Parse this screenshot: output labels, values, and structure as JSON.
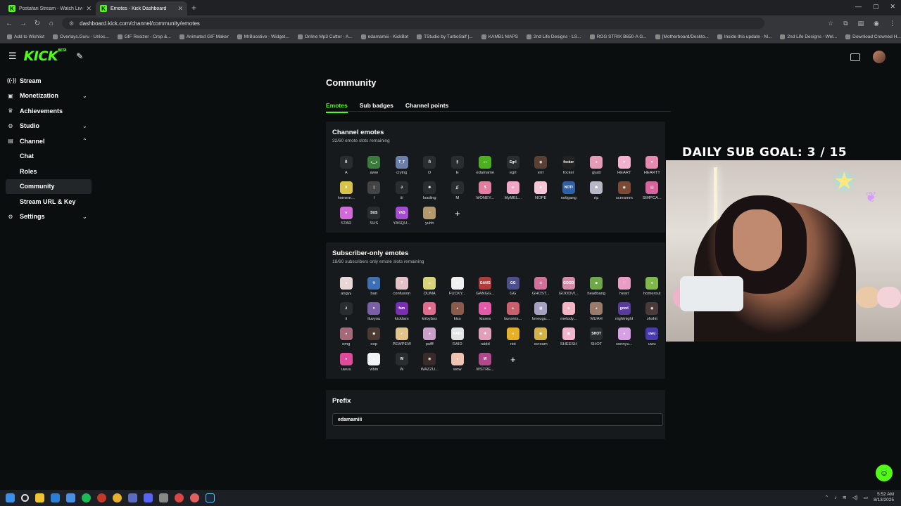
{
  "browser": {
    "tabs": [
      {
        "title": "Postafari Stream - Watch Live on K",
        "active": false
      },
      {
        "title": "Emotes - Kick Dashboard",
        "active": true
      }
    ],
    "url": "dashboard.kick.com/channel/community/emotes",
    "bookmarks": [
      "Add to Wishlist",
      "Overlays.Guru - Unloc...",
      "GIF Resizer - Crop &...",
      "Animated GIF Maker",
      "MrBoostive - Widget...",
      "Online Mp3 Cutter - A...",
      "edamamiii - KickBot",
      "TStudio by TurboSalf |...",
      "KAMB1 MAPS",
      "2nd Life Designs - LS...",
      "ROG STRIX B650-A G...",
      "[Motherboard/Deskto...",
      "Inside this update - M...",
      "2nd Life Designs - Wel...",
      "Download Crowned H..."
    ]
  },
  "header": {
    "logo": "KICK",
    "beta": "BETA"
  },
  "sidebar": {
    "items": [
      {
        "label": "Stream",
        "icon": "stream-icon",
        "glyph": "((·))",
        "chev": ""
      },
      {
        "label": "Monetization",
        "icon": "dollar-icon",
        "glyph": "▣",
        "chev": "⌄"
      },
      {
        "label": "Achievements",
        "icon": "trophy-icon",
        "glyph": "♛",
        "chev": ""
      },
      {
        "label": "Studio",
        "icon": "studio-icon",
        "glyph": "⚙",
        "chev": "⌄"
      },
      {
        "label": "Channel",
        "icon": "channel-icon",
        "glyph": "▤",
        "chev": "⌃"
      }
    ],
    "channel_sub": [
      "Chat",
      "Roles",
      "Community",
      "Stream URL & Key"
    ],
    "settings": {
      "label": "Settings",
      "glyph": "⚙",
      "chev": "⌄"
    }
  },
  "main": {
    "title": "Community",
    "tabs": [
      "Emotes",
      "Sub badges",
      "Channel points"
    ],
    "channel_emotes": {
      "title": "Channel emotes",
      "subtitle": "32/60 emote slots remaining",
      "emotes": [
        {
          "label": "A",
          "color": "#2a2d30",
          "glyph": "Ⴖ"
        },
        {
          "label": "aww",
          "color": "#3a7a3a",
          "glyph": "◕‿◕"
        },
        {
          "label": "crying",
          "color": "#6b7fa8",
          "glyph": "T_T"
        },
        {
          "label": "D",
          "color": "#2a2d30",
          "glyph": "Ⴖ"
        },
        {
          "label": "E",
          "color": "#2a2d30",
          "glyph": "§"
        },
        {
          "label": "edamame",
          "color": "#4caf1f",
          "glyph": "◖◗"
        },
        {
          "label": "egrl",
          "color": "#2a2d30",
          "glyph": "Egrl"
        },
        {
          "label": "errr",
          "color": "#5a4034",
          "glyph": "◉"
        },
        {
          "label": "focker",
          "color": "#222",
          "glyph": "focker"
        },
        {
          "label": "gyatt",
          "color": "#e59ab5",
          "glyph": "●"
        },
        {
          "label": "HEART",
          "color": "#f2b1cf",
          "glyph": "♥"
        },
        {
          "label": "HEARTT",
          "color": "#e68ab1",
          "glyph": "♥"
        },
        {
          "label": "homern...",
          "color": "#d8c34a",
          "glyph": "♜"
        },
        {
          "label": "I",
          "color": "#444",
          "glyph": "|"
        },
        {
          "label": "iii",
          "color": "#2a2d30",
          "glyph": "∂"
        },
        {
          "label": "loading",
          "color": "#2a2d30",
          "glyph": "✺"
        },
        {
          "label": "M",
          "color": "#2a2d30",
          "glyph": "∬"
        },
        {
          "label": "MONEY...",
          "color": "#e27ea0",
          "glyph": "$"
        },
        {
          "label": "MyMEL...",
          "color": "#f3a6c8",
          "glyph": "♣"
        },
        {
          "label": "NOPE",
          "color": "#f4c6d6",
          "glyph": "ᴥ"
        },
        {
          "label": "notigang",
          "color": "#2f5fa8",
          "glyph": "NOTI"
        },
        {
          "label": "rip",
          "color": "#b7b7c7",
          "glyph": "☗"
        },
        {
          "label": "screamm",
          "color": "#7a4a34",
          "glyph": "◉"
        },
        {
          "label": "SIMPCA...",
          "color": "#d9639c",
          "glyph": "▤"
        },
        {
          "label": "STAR",
          "color": "#d36adb",
          "glyph": "★"
        },
        {
          "label": "SUS",
          "color": "#2a2d30",
          "glyph": "SUS"
        },
        {
          "label": "YASQU...",
          "color": "#a34ccf",
          "glyph": "YAS"
        },
        {
          "label": "yuhh",
          "color": "#b49a6a",
          "glyph": "◔"
        }
      ]
    },
    "sub_emotes": {
      "title": "Subscriber-only emotes",
      "subtitle": "18/60 subscribers only emote slots remaining",
      "emotes": [
        {
          "label": "angyy",
          "color": "#e9d6d6",
          "glyph": "◕"
        },
        {
          "label": "ban",
          "color": "#3c6fb3",
          "glyph": "⚒"
        },
        {
          "label": "confusion",
          "color": "#e3c2c8",
          "glyph": "?"
        },
        {
          "label": "DUMA",
          "color": "#d9d47a",
          "glyph": "☺"
        },
        {
          "label": "FUCKY...",
          "color": "#f0f0f0",
          "glyph": "▭"
        },
        {
          "label": "GANGG...",
          "color": "#b23a3a",
          "glyph": "GANG"
        },
        {
          "label": "GG",
          "color": "#4b4f8c",
          "glyph": "GG"
        },
        {
          "label": "GHOST...",
          "color": "#d0709b",
          "glyph": "☠"
        },
        {
          "label": "GOODVI...",
          "color": "#d98aa8",
          "glyph": "GOOD"
        },
        {
          "label": "headbang",
          "color": "#6fa84a",
          "glyph": "☻"
        },
        {
          "label": "heart",
          "color": "#e99cc4",
          "glyph": "♡"
        },
        {
          "label": "homerout",
          "color": "#7fb94a",
          "glyph": "●"
        },
        {
          "label": "ii",
          "color": "#2a2d30",
          "glyph": "∂"
        },
        {
          "label": "iluvyou",
          "color": "#7a5fa8",
          "glyph": "♥"
        },
        {
          "label": "kickfam",
          "color": "#7a2fb0",
          "glyph": "fam"
        },
        {
          "label": "kirbybox",
          "color": "#e06b8c",
          "glyph": "◉"
        },
        {
          "label": "kiss",
          "color": "#8a5a4a",
          "glyph": "◕"
        },
        {
          "label": "kisses",
          "color": "#e55aa8",
          "glyph": "●"
        },
        {
          "label": "kuromis...",
          "color": "#c9606c",
          "glyph": "♠"
        },
        {
          "label": "loveugu...",
          "color": "#a8a0c0",
          "glyph": "▦"
        },
        {
          "label": "melody...",
          "color": "#f4b4c4",
          "glyph": "♣"
        },
        {
          "label": "MUAH",
          "color": "#9a7a6a",
          "glyph": "◕"
        },
        {
          "label": "nightnight",
          "color": "#5a3a9a",
          "glyph": "good"
        },
        {
          "label": "ohshit",
          "color": "#4a3a3a",
          "glyph": "◉"
        },
        {
          "label": "omg",
          "color": "#a46a7a",
          "glyph": "◕"
        },
        {
          "label": "oop",
          "color": "#4a3a32",
          "glyph": "◉"
        },
        {
          "label": "PEWPEW",
          "color": "#e0c48a",
          "glyph": "➶"
        },
        {
          "label": "pufff",
          "color": "#c9a0c8",
          "glyph": "◕"
        },
        {
          "label": "RAID",
          "color": "#e4e4e4",
          "glyph": "RAID"
        },
        {
          "label": "raidd",
          "color": "#e0a0b8",
          "glyph": "✚"
        },
        {
          "label": "riot",
          "color": "#e8b02a",
          "glyph": "◕"
        },
        {
          "label": "scream",
          "color": "#d3b24a",
          "glyph": "◉"
        },
        {
          "label": "SHEESH",
          "color": "#f1b4ca",
          "glyph": "▣"
        },
        {
          "label": "SHOT",
          "color": "#2a2d30",
          "glyph": "SHOT"
        },
        {
          "label": "sonnyu...",
          "color": "#d8a0e4",
          "glyph": "◕"
        },
        {
          "label": "uwu",
          "color": "#4a3ab0",
          "glyph": "uwu"
        },
        {
          "label": "uwuu",
          "color": "#e04a9a",
          "glyph": "●"
        },
        {
          "label": "vibin",
          "color": "#f2f2f2",
          "glyph": "◕"
        },
        {
          "label": "W",
          "color": "#2a2d30",
          "glyph": "W"
        },
        {
          "label": "WAZZU...",
          "color": "#3a2a2a",
          "glyph": "◉"
        },
        {
          "label": "wow",
          "color": "#f0c2b0",
          "glyph": "◕"
        },
        {
          "label": "WSTRE...",
          "color": "#b0488c",
          "glyph": "W"
        }
      ]
    },
    "prefix": {
      "title": "Prefix",
      "value": "edamamiii"
    }
  },
  "overlay": {
    "goal_text": "DAILY SUB GOAL: 3 / 15"
  },
  "tray": {
    "time": "5:52 AM",
    "date": "8/13/2025"
  }
}
